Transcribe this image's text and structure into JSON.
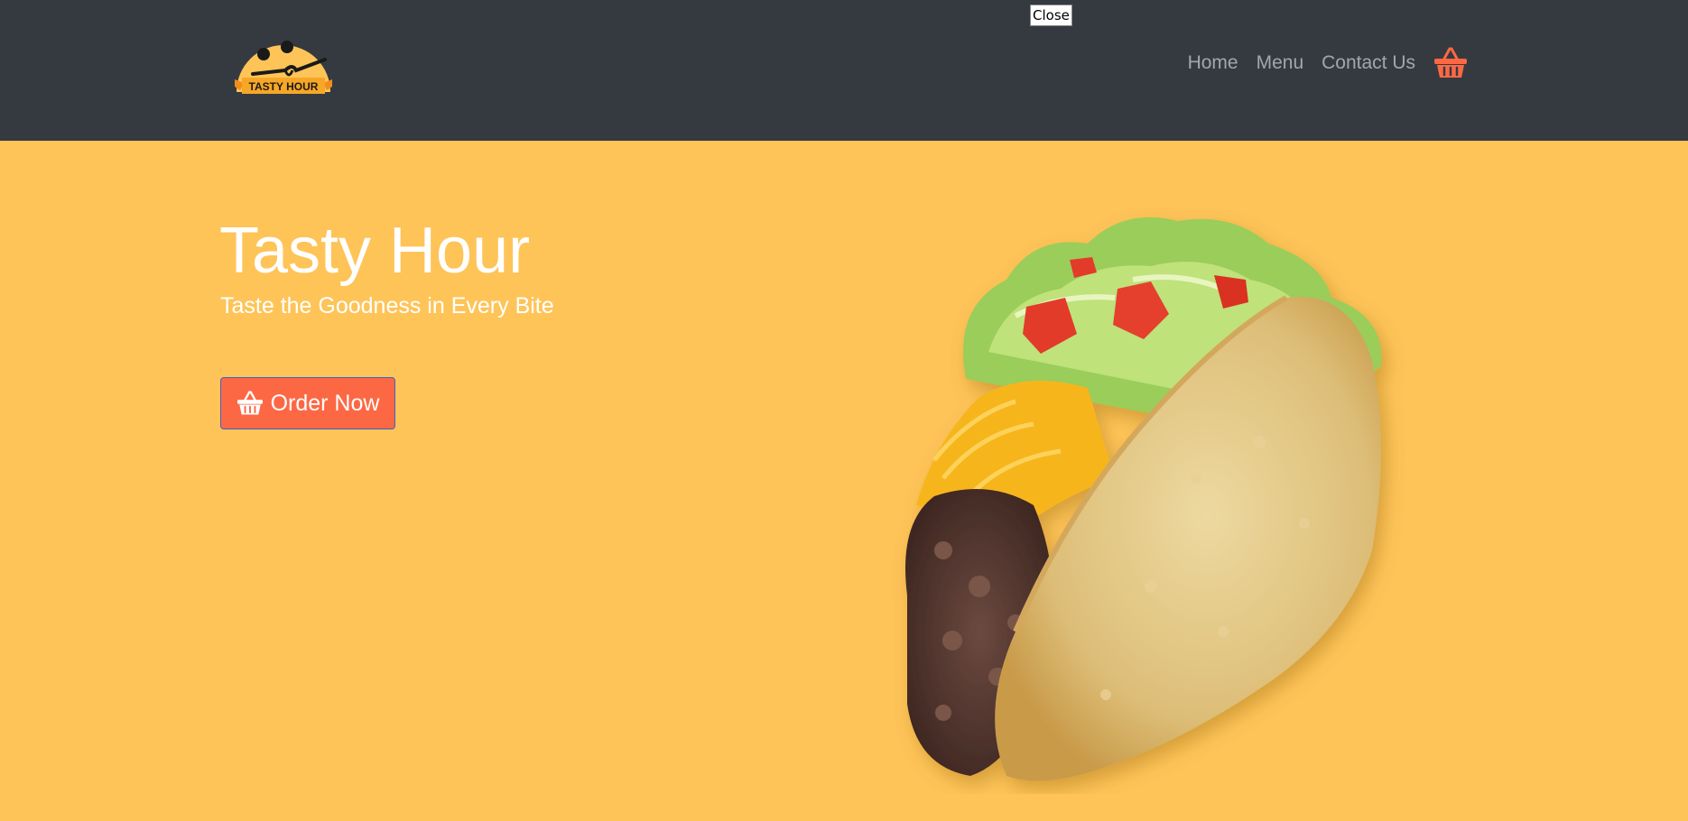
{
  "brand": {
    "logo_text": "TASTY HOUR"
  },
  "nav": {
    "items": [
      {
        "label": "Home"
      },
      {
        "label": "Menu"
      },
      {
        "label": "Contact Us"
      }
    ],
    "cart_icon": "basket-icon"
  },
  "overlay": {
    "close_label": "Close"
  },
  "hero": {
    "title": "Tasty Hour",
    "subtitle": "Taste the Goodness in Every Bite",
    "cta_label": "Order Now",
    "cta_icon": "basket-icon",
    "image": "taco-image"
  },
  "colors": {
    "navbar_bg": "#343A40",
    "hero_bg": "#FEC458",
    "accent": "#FD6844",
    "nav_text": "#9A9DA0",
    "hero_text": "#FFFFFF"
  }
}
